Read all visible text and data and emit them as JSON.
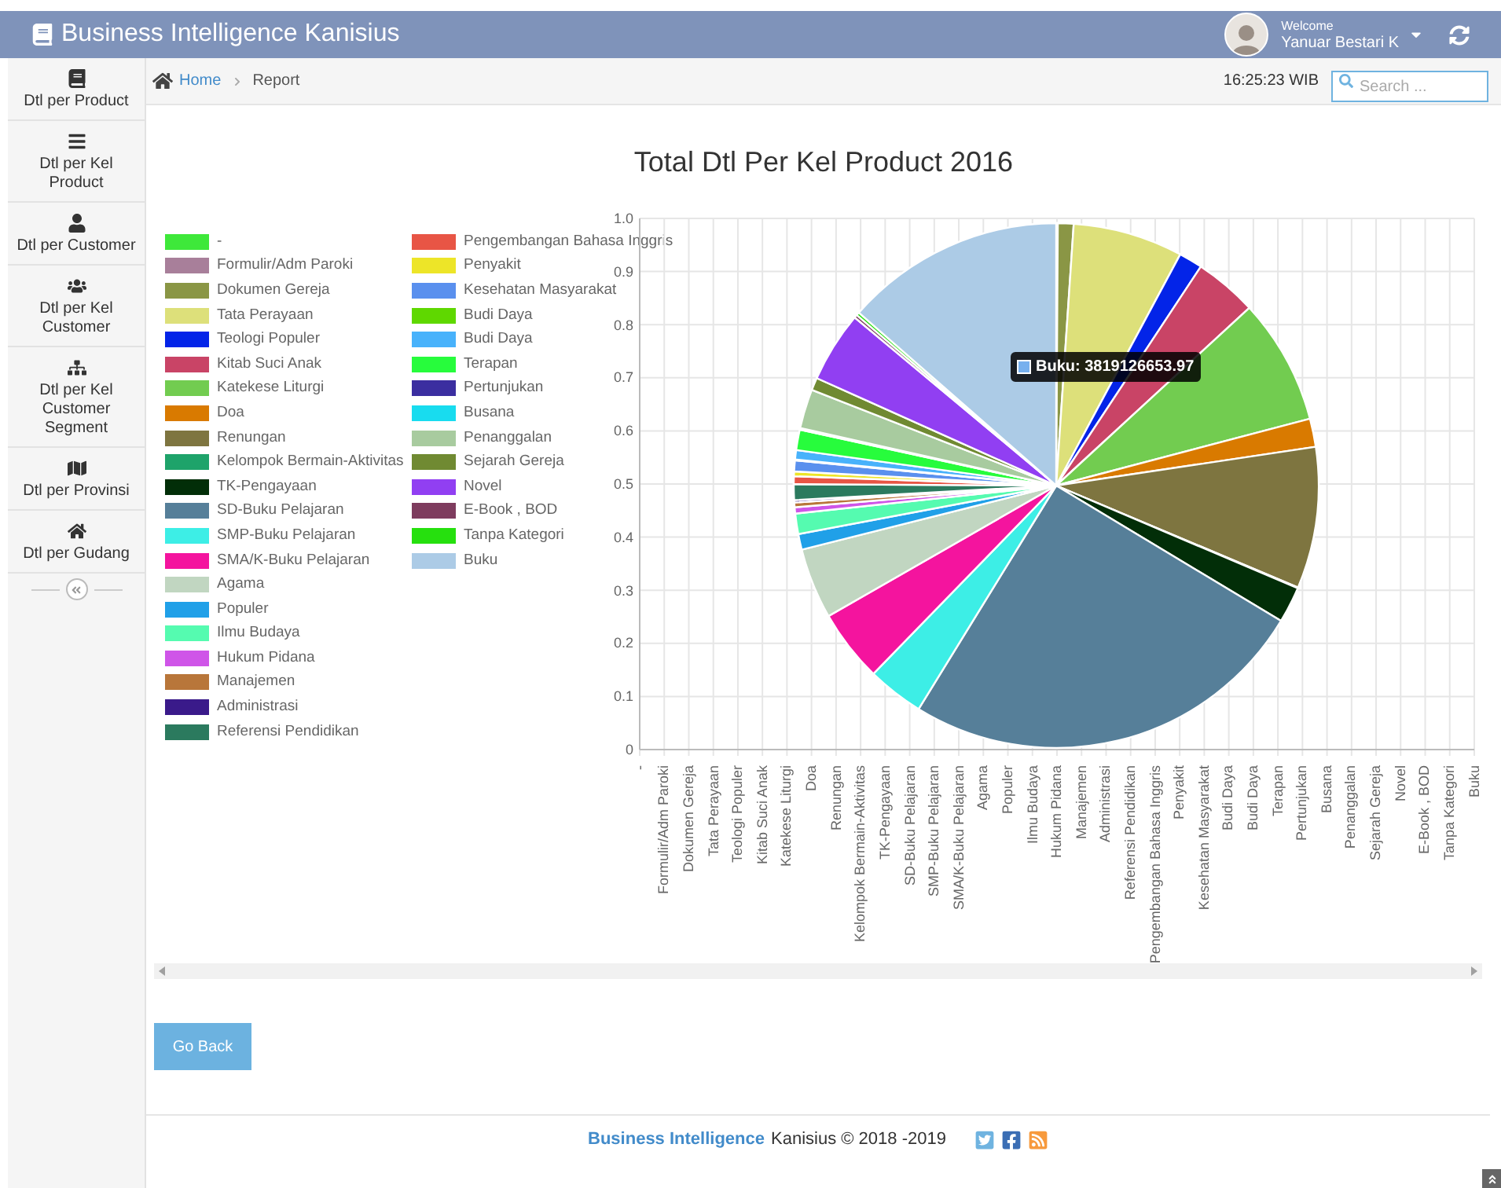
{
  "header": {
    "title": "Business Intelligence Kanisius",
    "welcome": "Welcome",
    "user": "Yanuar Bestari K"
  },
  "sidebar": {
    "items": [
      {
        "label": "Dtl per Product"
      },
      {
        "label": "Dtl per Kel Product"
      },
      {
        "label": "Dtl per Customer"
      },
      {
        "label": "Dtl per Kel Customer"
      },
      {
        "label": "Dtl per Kel Customer Segment"
      },
      {
        "label": "Dtl per Provinsi"
      },
      {
        "label": "Dtl per Gudang"
      }
    ]
  },
  "breadcrumb": {
    "home": "Home",
    "current": "Report",
    "time": "16:25:23 WIB",
    "search": {
      "placeholder": "Search ..."
    }
  },
  "chart": {
    "title": "Total Dtl Per Kel Product 2016",
    "legend": [
      {
        "label": "-",
        "color": "#3ee83a"
      },
      {
        "label": "Formulir/Adm Paroki",
        "color": "#a87f9a"
      },
      {
        "label": "Dokumen Gereja",
        "color": "#8a9645"
      },
      {
        "label": "Tata Perayaan",
        "color": "#dde07a"
      },
      {
        "label": "Teologi Populer",
        "color": "#0324e8"
      },
      {
        "label": "Kitab Suci Anak",
        "color": "#c94466"
      },
      {
        "label": "Katekese Liturgi",
        "color": "#72cc50"
      },
      {
        "label": "Doa",
        "color": "#d97a00"
      },
      {
        "label": "Renungan",
        "color": "#7e7540"
      },
      {
        "label": "Kelompok Bermain-Aktivitas",
        "color": "#1ea36a"
      },
      {
        "label": "TK-Pengayaan",
        "color": "#022e08"
      },
      {
        "label": "SD-Buku Pelajaran",
        "color": "#567f99"
      },
      {
        "label": "SMP-Buku Pelajaran",
        "color": "#3deee6"
      },
      {
        "label": "SMA/K-Buku Pelajaran",
        "color": "#f4149e"
      },
      {
        "label": "Agama",
        "color": "#c1d6c1"
      },
      {
        "label": "Populer",
        "color": "#20a0e8"
      },
      {
        "label": "Ilmu Budaya",
        "color": "#55fbb0"
      },
      {
        "label": "Hukum Pidana",
        "color": "#cf55e8"
      },
      {
        "label": "Manajemen",
        "color": "#b8763a"
      },
      {
        "label": "Administrasi",
        "color": "#3a1a8a"
      },
      {
        "label": "Referensi Pendidikan",
        "color": "#2b7a5e"
      },
      {
        "label": "Pengembangan Bahasa Inggris",
        "color": "#e85545"
      },
      {
        "label": "Penyakit",
        "color": "#ede528"
      },
      {
        "label": "Kesehatan Masyarakat",
        "color": "#5a90ee"
      },
      {
        "label": "Budi Daya",
        "color": "#5fd800"
      },
      {
        "label": "Budi Daya",
        "color": "#48b2fb"
      },
      {
        "label": "Terapan",
        "color": "#27fc3c"
      },
      {
        "label": "Pertunjukan",
        "color": "#3b2ea0"
      },
      {
        "label": "Busana",
        "color": "#18dcef"
      },
      {
        "label": "Penanggalan",
        "color": "#a8cb9f"
      },
      {
        "label": "Sejarah Gereja",
        "color": "#708a32"
      },
      {
        "label": "Novel",
        "color": "#913ff2"
      },
      {
        "label": "E-Book , BOD",
        "color": "#7e3c5e"
      },
      {
        "label": "Tanpa Kategori",
        "color": "#26e00e"
      },
      {
        "label": "Buku",
        "color": "#accbe6"
      }
    ],
    "y_ticks": [
      "1.0",
      "0.9",
      "0.8",
      "0.7",
      "0.6",
      "0.5",
      "0.4",
      "0.3",
      "0.2",
      "0.1",
      "0"
    ],
    "x_labels": [
      "-",
      "Formulir/Adm Paroki",
      "Dokumen Gereja",
      "Tata Perayaan",
      "Teologi Populer",
      "Kitab Suci Anak",
      "Katekese Liturgi",
      "Doa",
      "Renungan",
      "Kelompok Bermain-Aktivitas",
      "TK-Pengayaan",
      "SD-Buku Pelajaran",
      "SMP-Buku Pelajaran",
      "SMA/K-Buku Pelajaran",
      "Agama",
      "Populer",
      "Ilmu Budaya",
      "Hukum Pidana",
      "Manajemen",
      "Administrasi",
      "Referensi Pendidikan",
      "Pengembangan Bahasa Inggris",
      "Penyakit",
      "Kesehatan Masyarakat",
      "Budi Daya",
      "Budi Daya",
      "Terapan",
      "Pertunjukan",
      "Busana",
      "Penanggalan",
      "Sejarah Gereja",
      "Novel",
      "E-Book , BOD",
      "Tanpa Kategori",
      "Buku"
    ],
    "tooltip": {
      "text": "Buku: 3819126653.97",
      "color": "#77b0ee"
    }
  },
  "go_back": "Go Back",
  "footer": {
    "brand": "Business Intelligence",
    "text": "Kanisius © 2018 -2019"
  }
}
